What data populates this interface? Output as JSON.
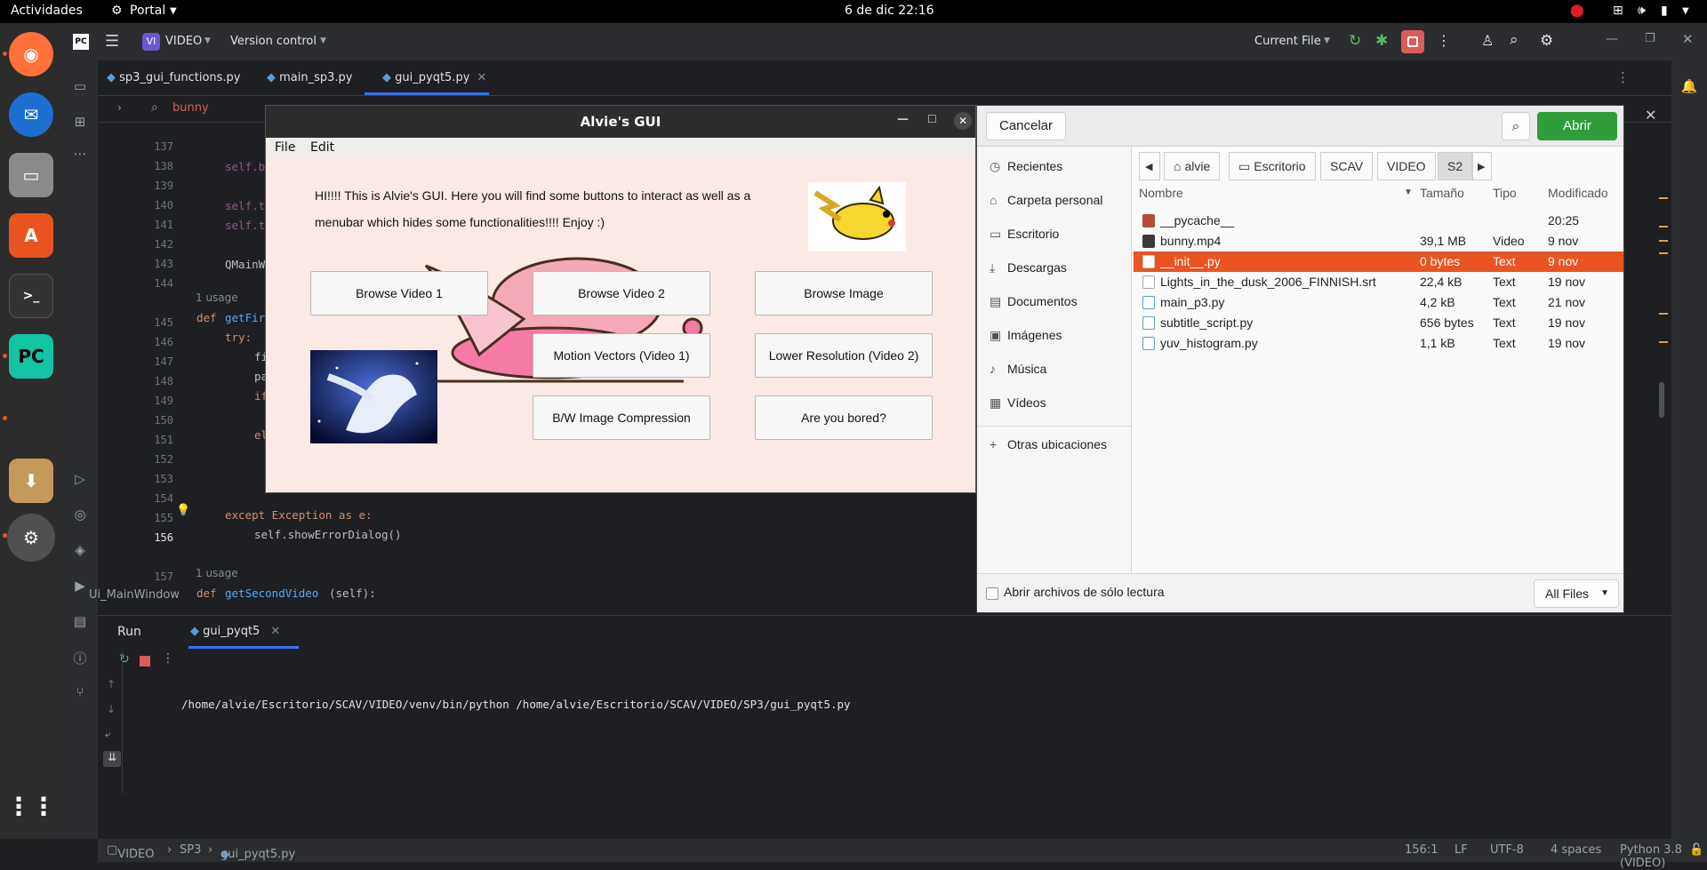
{
  "gnome": {
    "activities": "Actividades",
    "app_menu": "Portal",
    "clock": "6 de dic  22:16"
  },
  "ide": {
    "project_badge": "VI",
    "project": "VIDEO",
    "vcs": "Version control",
    "run_config": "Current File",
    "tabs": [
      "sp3_gui_functions.py",
      "main_sp3.py",
      "gui_pyqt5.py"
    ],
    "search_text": "bunny",
    "line_numbers": [
      "137",
      "138",
      "139",
      "140",
      "141",
      "142",
      "143",
      "144",
      "145",
      "146",
      "147",
      "148",
      "149",
      "150",
      "151",
      "152",
      "153",
      "154",
      "155",
      "156",
      "157"
    ],
    "code": {
      "l138": "self.b",
      "l140": "self.t",
      "l141": "self.t",
      "l143": "QMainW",
      "usage1": "1 usage",
      "def1_kw": "def",
      "def1_name": "getFir",
      "try": "try:",
      "l147": "fi",
      "l148": "pa",
      "l149": "if",
      "l151": "el",
      "l154": "except Exception as e:",
      "l155": "self.showErrorDialog()",
      "usage2": "1 usage",
      "def2_kw": "def",
      "def2_name": "getSecondVideo",
      "def2_args": "(self):"
    },
    "breadcrumb_class": "Ui_MainWindow",
    "run": {
      "tab_label": "Run",
      "config_tab": "gui_pyqt5",
      "command": "/home/alvie/Escritorio/SCAV/VIDEO/venv/bin/python /home/alvie/Escritorio/SCAV/VIDEO/SP3/gui_pyqt5.py"
    },
    "status": {
      "crumbs": [
        "VIDEO",
        "SP3",
        "gui_pyqt5.py"
      ],
      "position": "156:1",
      "line_sep": "LF",
      "encoding": "UTF-8",
      "indent": "4 spaces",
      "interpreter": "Python 3.8 (VIDEO)"
    }
  },
  "qt_window": {
    "title": "Alvie's GUI",
    "menu": [
      "File",
      "Edit"
    ],
    "intro": "HI!!!! This is Alvie's GUI. Here you will find some buttons to interact as well as a menubar which hides some functionalities!!!! Enjoy :)",
    "buttons": [
      "Browse Video 1",
      "Browse Video 2",
      "Browse Image",
      "Motion Vectors (Video 1)",
      "Lower Resolution (Video 2)",
      "B/W Image Compression",
      "Are you bored?"
    ]
  },
  "file_dialog": {
    "cancel": "Cancelar",
    "open": "Abrir",
    "path": [
      "alvie",
      "Escritorio",
      "SCAV",
      "VIDEO",
      "S2"
    ],
    "places": [
      "Recientes",
      "Carpeta personal",
      "Escritorio",
      "Descargas",
      "Documentos",
      "Imágenes",
      "Música",
      "Vídeos",
      "Otras ubicaciones"
    ],
    "columns": [
      "Nombre",
      "Tamaño",
      "Tipo",
      "Modificado"
    ],
    "files": [
      {
        "name": "__pycache__",
        "size": "",
        "type": "",
        "modified": "20:25",
        "kind": "folder"
      },
      {
        "name": "bunny.mp4",
        "size": "39,1 MB",
        "type": "Video",
        "modified": "9 nov",
        "kind": "video"
      },
      {
        "name": "__init__.py",
        "size": "0 bytes",
        "type": "Text",
        "modified": "9 nov",
        "kind": "text"
      },
      {
        "name": "Lights_in_the_dusk_2006_FINNISH.srt",
        "size": "22,4 kB",
        "type": "Text",
        "modified": "19 nov",
        "kind": "text"
      },
      {
        "name": "main_p3.py",
        "size": "4,2 kB",
        "type": "Text",
        "modified": "21 nov",
        "kind": "text"
      },
      {
        "name": "subtitle_script.py",
        "size": "656 bytes",
        "type": "Text",
        "modified": "19 nov",
        "kind": "text"
      },
      {
        "name": "yuv_histogram.py",
        "size": "1,1 kB",
        "type": "Text",
        "modified": "19 nov",
        "kind": "text"
      }
    ],
    "selected": "__init__.py",
    "readonly_label": "Abrir archivos de sólo lectura",
    "filter": "All Files"
  },
  "colors": {
    "accent": "#e95420",
    "open_button": "#2f9e3a",
    "ide_bg": "#1e1f22",
    "gui_bg": "#fae9e5"
  }
}
